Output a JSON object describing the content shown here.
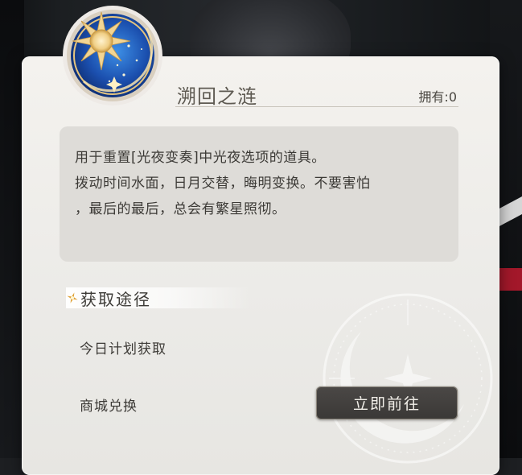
{
  "item": {
    "name": "溯回之涟",
    "owned_label": "拥有:",
    "owned_count": "0",
    "icon": "sun-moon-star-orb-icon"
  },
  "description": {
    "lines": [
      "用于重置[光夜变奏]中光夜选项的道具。",
      "拨动时间水面，日月交替，晦明变换。不要害怕",
      "，最后的最后，总会有繁星照彻。"
    ]
  },
  "acquire": {
    "heading": "获取途径",
    "sources": [
      {
        "label": "今日计划获取"
      },
      {
        "label": "商城兑换",
        "button": "立即前往"
      }
    ]
  },
  "colors": {
    "card": "#f4f2ee",
    "desc_box": "#dedcd8",
    "button": "#3f3d3b",
    "accent_gold": "#e3b96a",
    "accent_blue": "#1e5bb8"
  }
}
